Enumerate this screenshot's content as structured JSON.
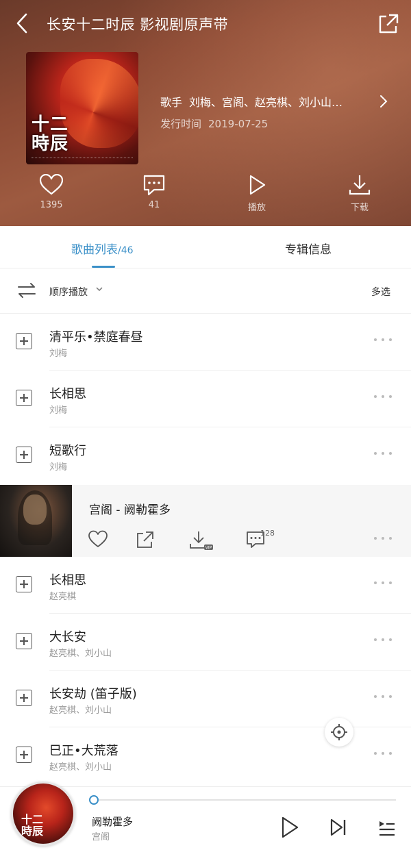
{
  "header": {
    "title": "长安十二时辰 影视剧原声带",
    "artist_label": "歌手",
    "artists": "刘梅、宫阁、赵亮棋、刘小山…",
    "release_label": "发行时间",
    "release_date": "2019-07-25",
    "cover_text": "十二\n時辰"
  },
  "actions": {
    "like_count": "1395",
    "comment_count": "41",
    "play_label": "播放",
    "download_label": "下载"
  },
  "tabs": {
    "songs_label": "歌曲列表",
    "songs_count": "/46",
    "info_label": "专辑信息"
  },
  "toolbar": {
    "play_mode": "顺序播放",
    "multi_select": "多选"
  },
  "songs_top": [
    {
      "name": "清平乐•禁庭春昼",
      "artist": "刘梅"
    },
    {
      "name": "长相思",
      "artist": "刘梅"
    },
    {
      "name": "短歌行",
      "artist": "刘梅"
    }
  ],
  "now_playing": {
    "title": "宫阁 - 阙勒霍多",
    "comment_badge": "128",
    "vip_label": "VIP"
  },
  "songs_bottom": [
    {
      "name": "长相思",
      "artist": "赵亮棋"
    },
    {
      "name": "大长安",
      "artist": "赵亮棋、刘小山"
    },
    {
      "name": "长安劫 (笛子版)",
      "artist": "赵亮棋、刘小山"
    },
    {
      "name": "巳正•大荒落",
      "artist": "赵亮棋、刘小山"
    }
  ],
  "mini_player": {
    "title": "阙勒霍多",
    "artist": "宫阁",
    "progress": 0.0
  },
  "colors": {
    "accent": "#3b90c8",
    "header_bg": "#8c4a34"
  }
}
